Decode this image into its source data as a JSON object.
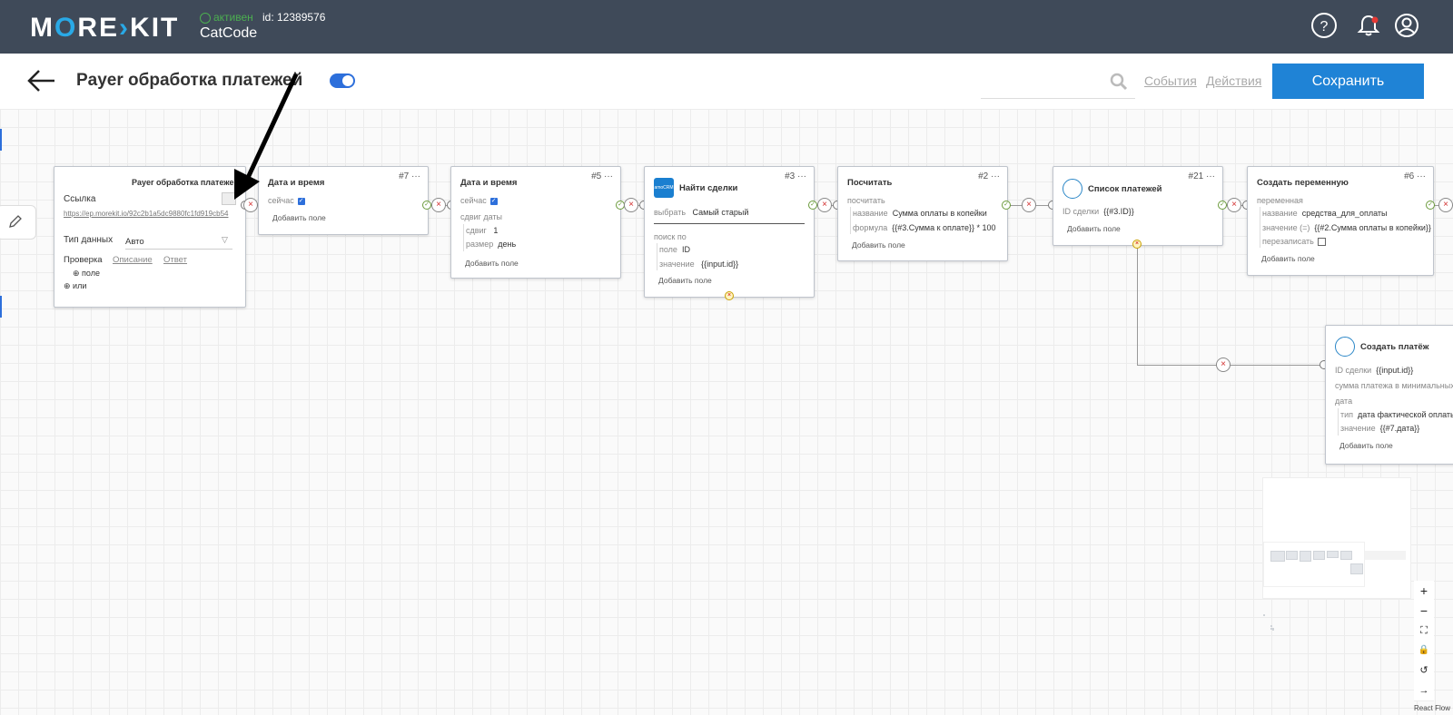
{
  "topbar": {
    "logo_text": "MORE KIT",
    "status": "активен",
    "account_id": "id: 12389576",
    "account_name": "CatCode",
    "icons": [
      "help-icon",
      "bell-icon",
      "user-icon"
    ]
  },
  "header": {
    "title": "Payer обработка платежей",
    "search_placeholder": "",
    "link_events": "События",
    "link_actions": "Действия",
    "save_label": "Сохранить"
  },
  "colors": {
    "accent": "#1f83d6",
    "topbar": "#3f4a59",
    "toggle": "#2d6fdb"
  },
  "nodes": {
    "trigger": {
      "title": "Payer обработка платежей",
      "link_label": "Ссылка",
      "url": "https://ep.morekit.io/92c2b1a5dc9880fc1fd919cb54",
      "data_type_label": "Тип данных",
      "data_type_value": "Авто",
      "tab_check": "Проверка",
      "tab_desc": "Описание",
      "tab_answer": "Ответ",
      "add_field": "поле",
      "add_or": "или"
    },
    "dt7": {
      "title": "Дата и время",
      "num": "#7",
      "now": "сейчас",
      "add": "Добавить поле"
    },
    "dt5": {
      "title": "Дата и время",
      "num": "#5",
      "now": "сейчас",
      "shift_date": "сдвиг даты",
      "shift_label": "сдвиг",
      "shift_value": "1",
      "size_label": "размер",
      "size_value": "день",
      "add": "Добавить поле"
    },
    "find3": {
      "title": "Найти сделки",
      "num": "#3",
      "choose_label": "выбрать",
      "choose_value": "Самый старый",
      "search_by": "поиск по",
      "field_label": "поле",
      "field_value": "ID",
      "value_label": "значение",
      "value_value": "{{input.id}}",
      "add": "Добавить поле",
      "logo_text": "amoCRM"
    },
    "calc2": {
      "title": "Посчитать",
      "num": "#2",
      "calc": "посчитать",
      "name_label": "название",
      "name_value": "Сумма оплаты в копейки",
      "formula_label": "формула",
      "formula_value": "{{#3.Сумма к оплате}} * 100",
      "add": "Добавить поле"
    },
    "list21": {
      "title": "Список платежей",
      "num": "#21",
      "deal_label": "ID сделки",
      "deal_value": "{{#3.ID}}",
      "add": "Добавить поле"
    },
    "var6": {
      "title": "Создать переменную",
      "num": "#6",
      "var": "переменная",
      "name_label": "название",
      "name_value": "средства_для_оплаты",
      "value_label": "значение (=)",
      "value_value": "{{#2.Сумма оплаты в копейки}}",
      "overwrite_label": "перезаписать",
      "add": "Добавить поле"
    },
    "pay": {
      "title": "Создать платёж",
      "deal_label": "ID сделки",
      "deal_value": "{{input.id}}",
      "amount_label": "сумма платежа в минимальных",
      "date_label": "дата",
      "type_label": "тип",
      "type_value": "дата фактической оплаты",
      "value_label": "значение",
      "value_value": "{{#7.дата}}",
      "add": "Добавить поле"
    }
  },
  "flow_controls": [
    "+",
    "−",
    "⛶",
    "🔒",
    "↺",
    "→"
  ],
  "react_flow_label": "React Flow"
}
